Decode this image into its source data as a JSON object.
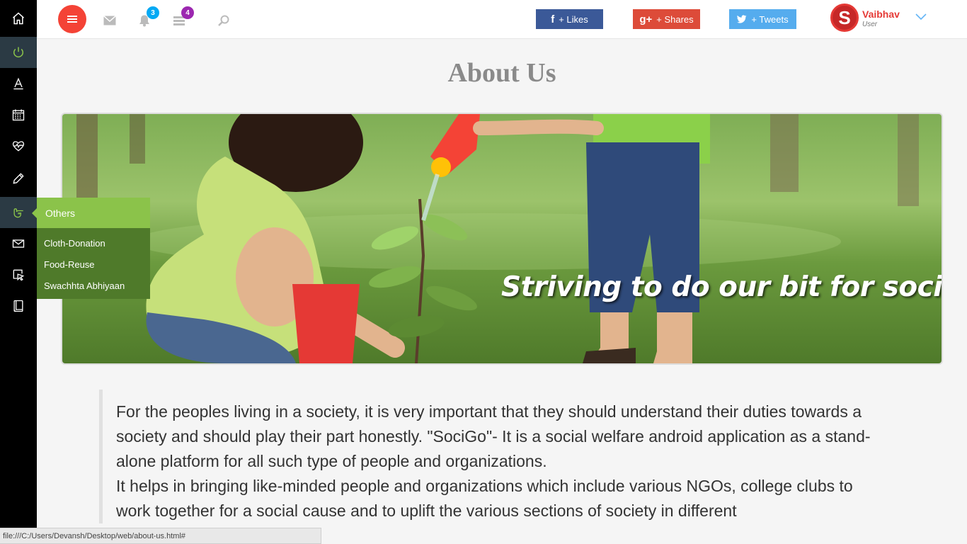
{
  "sidebar": {
    "items": [
      {
        "name": "home-icon",
        "active": false
      },
      {
        "name": "power-icon",
        "active": true
      },
      {
        "name": "font-icon",
        "active": false
      },
      {
        "name": "calendar-icon",
        "active": false
      },
      {
        "name": "heartbeat-icon",
        "active": false
      },
      {
        "name": "pencil-icon",
        "active": false
      },
      {
        "name": "hand-pointer-icon",
        "active": true
      },
      {
        "name": "envelope-icon",
        "active": false
      },
      {
        "name": "cursor-select-icon",
        "active": false
      },
      {
        "name": "book-icon",
        "active": false
      }
    ],
    "flyout": {
      "title": "Others",
      "items": [
        "Cloth-Donation",
        "Food-Reuse",
        "Swachhta Abhiyaan"
      ]
    }
  },
  "topbar": {
    "notifications_count": "3",
    "tasks_count": "4",
    "social": {
      "facebook": {
        "glyph": "f",
        "label": "+ Likes",
        "color": "#3b5998"
      },
      "google": {
        "glyph": "g+",
        "label": "+ Shares",
        "color": "#dd4b39"
      },
      "twitter": {
        "glyph": "t",
        "label": "+ Tweets",
        "color": "#55acee"
      }
    },
    "user": {
      "avatar_letter": "S",
      "name": "Vaibhav",
      "role": "User"
    }
  },
  "main": {
    "title": "About Us",
    "banner_caption": "Striving to do our bit for society",
    "paragraph_1": "For the peoples living in a society, it is very important that they should understand their duties towards a society and should play their part honestly. \"SociGo\"- It is a social welfare android application as a stand-alone platform for all such type of people and organizations.",
    "paragraph_2": "It helps in bringing like-minded people and organizations which include various NGOs, college clubs to work together for a social cause and to uplift the various sections of society in different"
  },
  "status_bar": {
    "url": "file:///C:/Users/Devansh/Desktop/web/about-us.html#"
  },
  "colors": {
    "accent_red": "#f44336",
    "flyout_green": "#8bc34a",
    "flyout_dark_green": "#4f7a2a",
    "badge_blue": "#03a9f4",
    "badge_purple": "#9c27b0"
  }
}
